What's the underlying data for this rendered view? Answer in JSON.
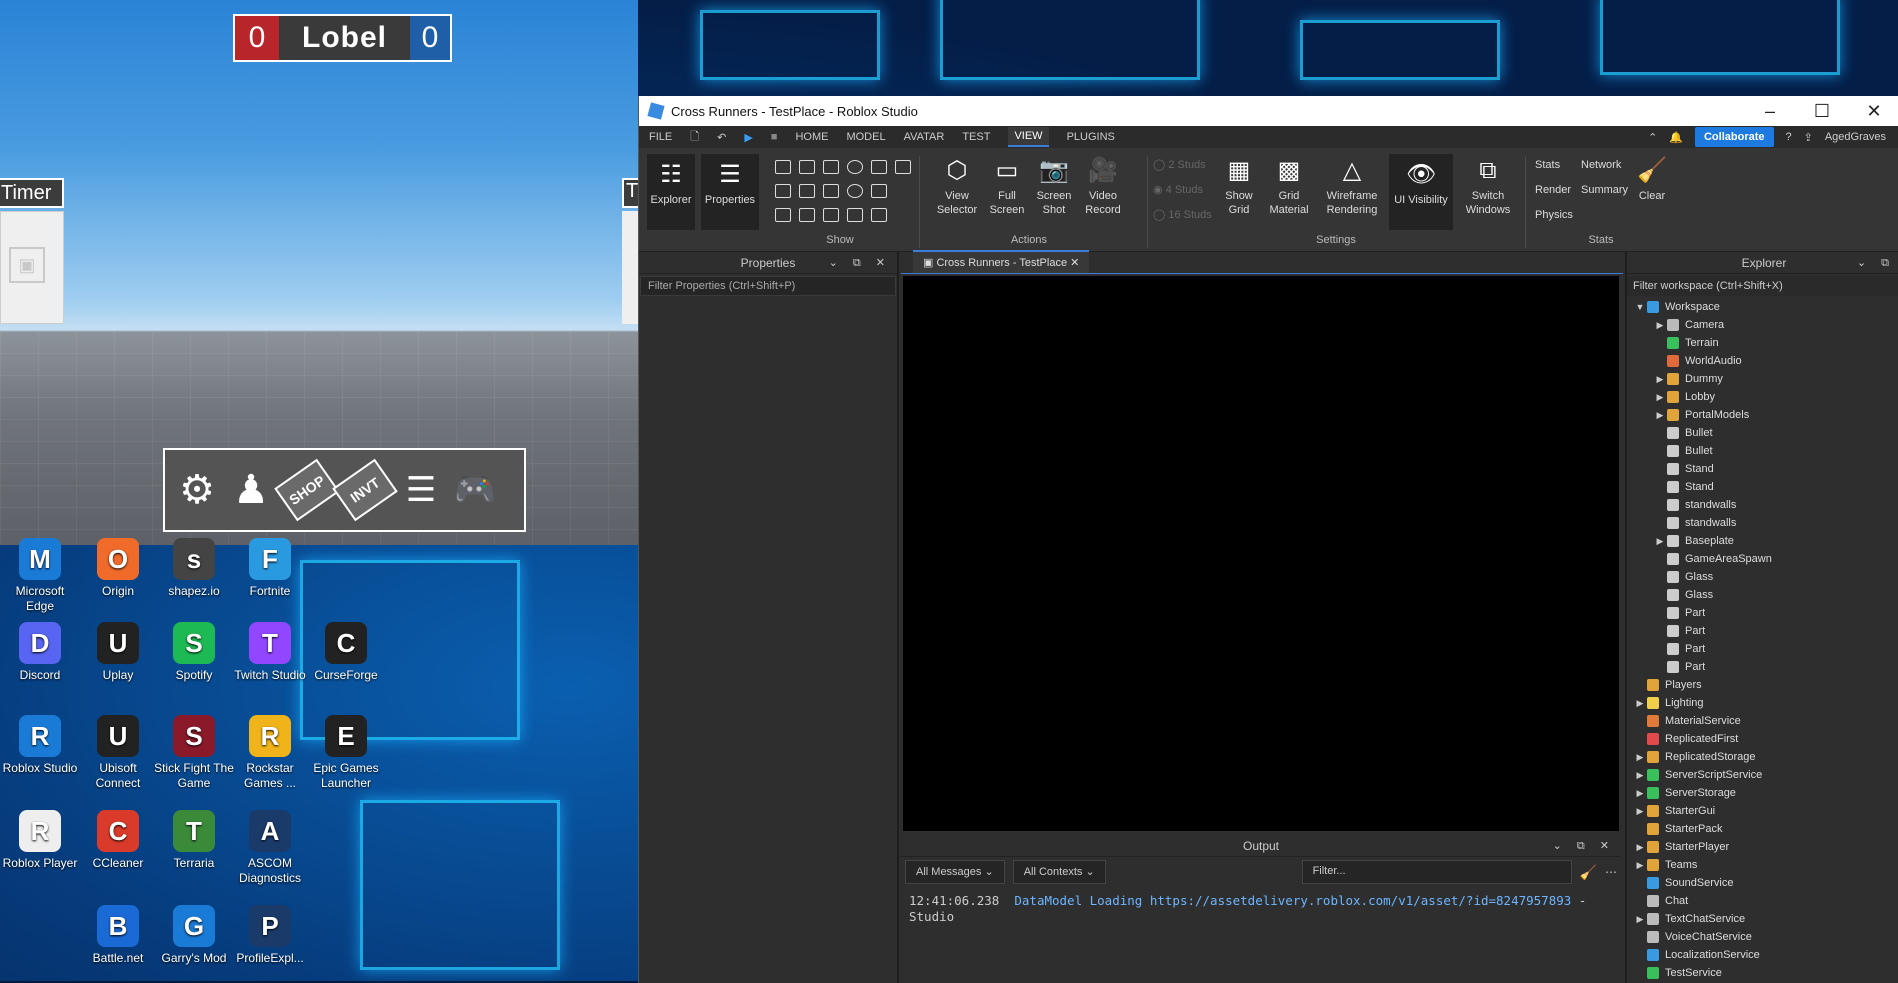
{
  "game": {
    "score_left": "0",
    "score_label": "Lobel",
    "score_right": "0",
    "timer_label": "Timer",
    "timer_label_2": "T",
    "hotbar": [
      "settings-icon",
      "avatar-icon",
      "SHOP",
      "INVT",
      "list-icon",
      "gamepad-icon"
    ]
  },
  "desktop": {
    "icons": [
      {
        "label": "Microsoft Edge",
        "icon": "edge-icon",
        "color": "#1a7bd6"
      },
      {
        "label": "Origin",
        "icon": "origin-icon",
        "color": "#f06a2a"
      },
      {
        "label": "shapez.io",
        "icon": "shapez-icon",
        "color": "#444"
      },
      {
        "label": "Fortnite",
        "icon": "fortnite-icon",
        "color": "#2a9ae0"
      },
      {
        "label": "Discord",
        "icon": "discord-icon",
        "color": "#5865f2"
      },
      {
        "label": "Uplay",
        "icon": "uplay-icon",
        "color": "#222"
      },
      {
        "label": "Spotify",
        "icon": "spotify-icon",
        "color": "#1db954"
      },
      {
        "label": "Twitch Studio",
        "icon": "twitch-icon",
        "color": "#9146ff"
      },
      {
        "label": "CurseForge",
        "icon": "curseforge-icon",
        "color": "#222"
      },
      {
        "label": "Roblox Studio",
        "icon": "roblox-studio-icon",
        "color": "#1a7bd6"
      },
      {
        "label": "Ubisoft Connect",
        "icon": "ubisoft-icon",
        "color": "#222"
      },
      {
        "label": "Stick Fight The Game",
        "icon": "stickfight-icon",
        "color": "#8a1a2a"
      },
      {
        "label": "Rockstar Games ...",
        "icon": "rockstar-icon",
        "color": "#f0b31a"
      },
      {
        "label": "Epic Games Launcher",
        "icon": "epic-icon",
        "color": "#222"
      },
      {
        "label": "Roblox Player",
        "icon": "roblox-player-icon",
        "color": "#eee"
      },
      {
        "label": "CCleaner",
        "icon": "ccleaner-icon",
        "color": "#d93a2a"
      },
      {
        "label": "Terraria",
        "icon": "terraria-icon",
        "color": "#3a8a3a"
      },
      {
        "label": "ASCOM Diagnostics",
        "icon": "ascom-icon",
        "color": "#1a3a6a"
      },
      {
        "label": "Battle.net",
        "icon": "battlenet-icon",
        "color": "#1a6ad6"
      },
      {
        "label": "Garry's Mod",
        "icon": "gmod-icon",
        "color": "#1a7bd6"
      },
      {
        "label": "ProfileExpl...",
        "icon": "ascom-profile-icon",
        "color": "#1a3a6a"
      }
    ]
  },
  "studio": {
    "title": "Cross Runners - TestPlace - Roblox Studio",
    "menu": {
      "file": "FILE",
      "tabs": [
        "HOME",
        "MODEL",
        "AVATAR",
        "TEST",
        "VIEW",
        "PLUGINS"
      ],
      "active_tab": "VIEW",
      "collaborate": "Collaborate",
      "user": "AgedGraves"
    },
    "ribbon": {
      "explorer": "Explorer",
      "properties": "Properties",
      "show_group": "Show",
      "view_selector": "View\nSelector",
      "full_screen": "Full\nScreen",
      "screen_shot": "Screen\nShot",
      "video_record": "Video\nRecord",
      "actions_group": "Actions",
      "studs_2": "2 Studs",
      "studs_4": "4 Studs",
      "studs_16": "16 Studs",
      "show_grid": "Show\nGrid",
      "grid_material": "Grid\nMaterial",
      "wireframe": "Wireframe\nRendering",
      "ui_visibility": "UI Visibility",
      "switch_windows": "Switch\nWindows",
      "settings_group": "Settings",
      "stats": "Stats",
      "network": "Network",
      "render": "Render",
      "summary": "Summary",
      "physics": "Physics",
      "clear": "Clear",
      "stats_group": "Stats"
    },
    "properties": {
      "title": "Properties",
      "filter_placeholder": "Filter Properties (Ctrl+Shift+P)"
    },
    "document_tab": "Cross Runners - TestPlace",
    "output": {
      "title": "Output",
      "messages": "All Messages",
      "contexts": "All Contexts",
      "filter": "Filter...",
      "log_time": "12:41:06.238",
      "log_text": "DataModel Loading",
      "log_url": "https://assetdelivery.roblox.com/v1/asset/?id=8247957893",
      "log_suffix": " -  Studio"
    },
    "explorer": {
      "title": "Explorer",
      "filter_placeholder": "Filter workspace (Ctrl+Shift+X)",
      "tree": [
        {
          "label": "Workspace",
          "level": 0,
          "arrow": "down",
          "color": "#3a9ae0"
        },
        {
          "label": "Camera",
          "level": 1,
          "arrow": "right",
          "color": "#bbb"
        },
        {
          "label": "Terrain",
          "level": 1,
          "arrow": "",
          "color": "#3ac05a"
        },
        {
          "label": "WorldAudio",
          "level": 1,
          "arrow": "",
          "color": "#e06a3a"
        },
        {
          "label": "Dummy",
          "level": 1,
          "arrow": "right",
          "color": "#e0a43a"
        },
        {
          "label": "Lobby",
          "level": 1,
          "arrow": "right",
          "color": "#e0a43a"
        },
        {
          "label": "PortalModels",
          "level": 1,
          "arrow": "right",
          "color": "#e0a43a"
        },
        {
          "label": "Bullet",
          "level": 1,
          "arrow": "",
          "color": "#ccc"
        },
        {
          "label": "Bullet",
          "level": 1,
          "arrow": "",
          "color": "#ccc"
        },
        {
          "label": "Stand",
          "level": 1,
          "arrow": "",
          "color": "#ccc"
        },
        {
          "label": "Stand",
          "level": 1,
          "arrow": "",
          "color": "#ccc"
        },
        {
          "label": "standwalls",
          "level": 1,
          "arrow": "",
          "color": "#ccc"
        },
        {
          "label": "standwalls",
          "level": 1,
          "arrow": "",
          "color": "#ccc"
        },
        {
          "label": "Baseplate",
          "level": 1,
          "arrow": "right",
          "color": "#ccc"
        },
        {
          "label": "GameAreaSpawn",
          "level": 1,
          "arrow": "",
          "color": "#ccc"
        },
        {
          "label": "Glass",
          "level": 1,
          "arrow": "",
          "color": "#ccc"
        },
        {
          "label": "Glass",
          "level": 1,
          "arrow": "",
          "color": "#ccc"
        },
        {
          "label": "Part",
          "level": 1,
          "arrow": "",
          "color": "#ccc"
        },
        {
          "label": "Part",
          "level": 1,
          "arrow": "",
          "color": "#ccc"
        },
        {
          "label": "Part",
          "level": 1,
          "arrow": "",
          "color": "#ccc"
        },
        {
          "label": "Part",
          "level": 1,
          "arrow": "",
          "color": "#ccc"
        },
        {
          "label": "Players",
          "level": 0,
          "arrow": "",
          "color": "#e0a43a"
        },
        {
          "label": "Lighting",
          "level": 0,
          "arrow": "right",
          "color": "#f0d04a"
        },
        {
          "label": "MaterialService",
          "level": 0,
          "arrow": "",
          "color": "#e07a3a"
        },
        {
          "label": "ReplicatedFirst",
          "level": 0,
          "arrow": "",
          "color": "#e04a4a"
        },
        {
          "label": "ReplicatedStorage",
          "level": 0,
          "arrow": "right",
          "color": "#e0a43a"
        },
        {
          "label": "ServerScriptService",
          "level": 0,
          "arrow": "right",
          "color": "#3ac05a"
        },
        {
          "label": "ServerStorage",
          "level": 0,
          "arrow": "right",
          "color": "#3ac05a"
        },
        {
          "label": "StarterGui",
          "level": 0,
          "arrow": "right",
          "color": "#e0a43a"
        },
        {
          "label": "StarterPack",
          "level": 0,
          "arrow": "",
          "color": "#e0a43a"
        },
        {
          "label": "StarterPlayer",
          "level": 0,
          "arrow": "right",
          "color": "#e0a43a"
        },
        {
          "label": "Teams",
          "level": 0,
          "arrow": "right",
          "color": "#e0a43a"
        },
        {
          "label": "SoundService",
          "level": 0,
          "arrow": "",
          "color": "#3a9ae0"
        },
        {
          "label": "Chat",
          "level": 0,
          "arrow": "",
          "color": "#bbb"
        },
        {
          "label": "TextChatService",
          "level": 0,
          "arrow": "right",
          "color": "#bbb"
        },
        {
          "label": "VoiceChatService",
          "level": 0,
          "arrow": "",
          "color": "#bbb"
        },
        {
          "label": "LocalizationService",
          "level": 0,
          "arrow": "",
          "color": "#3a9ae0"
        },
        {
          "label": "TestService",
          "level": 0,
          "arrow": "",
          "color": "#3ac05a"
        }
      ]
    }
  }
}
